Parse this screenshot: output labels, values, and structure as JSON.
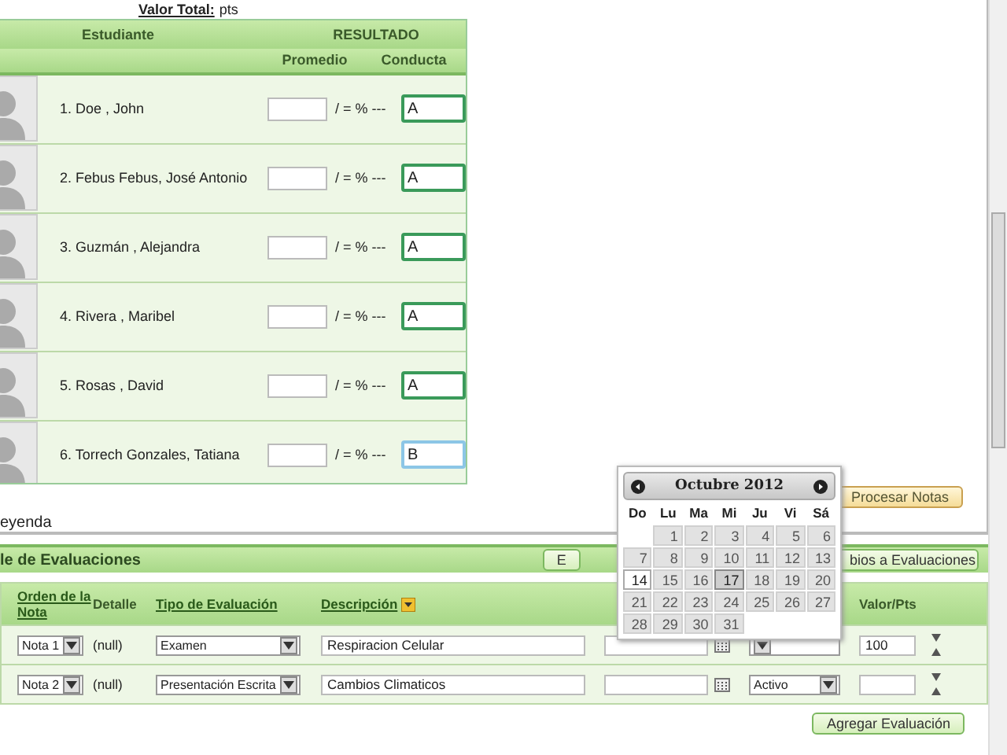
{
  "summary": {
    "label": "Valor Total:",
    "unit": "pts"
  },
  "students_table": {
    "headers": {
      "student": "Estudiante",
      "result": "RESULTADO",
      "average": "Promedio",
      "conduct": "Conducta"
    },
    "rows": [
      {
        "name": "1. Doe , John",
        "formula": "/ = % ---",
        "conduct": "A",
        "focused": false
      },
      {
        "name": "2. Febus Febus, José Antonio",
        "formula": "/ = % ---",
        "conduct": "A",
        "focused": false
      },
      {
        "name": "3. Guzmán , Alejandra",
        "formula": "/ = % ---",
        "conduct": "A",
        "focused": false
      },
      {
        "name": "4. Rivera , Maribel",
        "formula": "/ = % ---",
        "conduct": "A",
        "focused": false
      },
      {
        "name": "5. Rosas , David",
        "formula": "/ = % ---",
        "conduct": "A",
        "focused": false
      },
      {
        "name": "6. Torrech Gonzales, Tatiana",
        "formula": "/ = % ---",
        "conduct": "B",
        "focused": true
      }
    ]
  },
  "legend": "eyenda",
  "process_button": "Procesar Notas",
  "evaluations": {
    "title": "le de Evaluaciones",
    "buttons": [
      "E",
      "bios a Evaluaciones"
    ],
    "columns": {
      "order": "Orden de la Nota",
      "detail": "Detalle",
      "type": "Tipo de Evaluación",
      "description": "Descripción",
      "value": "Valor/Pts"
    },
    "rows": [
      {
        "order": "Nota 1",
        "detail": "(null)",
        "type": "Examen",
        "description": "Respiracion Celular",
        "status": null,
        "value": "100"
      },
      {
        "order": "Nota 2",
        "detail": "(null)",
        "type": "Presentación Escrita",
        "description": "Cambios Climaticos",
        "status": "Activo",
        "value": null
      }
    ],
    "add_button": "Agregar Evaluación"
  },
  "datepicker": {
    "title": "Octubre 2012",
    "weekdays": [
      "Do",
      "Lu",
      "Ma",
      "Mi",
      "Ju",
      "Vi",
      "Sá"
    ],
    "weeks": [
      {
        "days": [
          {
            "label": "1",
            "today": false,
            "selected": false
          },
          {
            "label": "2",
            "today": false,
            "selected": false
          },
          {
            "label": "3",
            "today": false,
            "selected": false
          },
          {
            "label": "4",
            "today": false,
            "selected": false
          },
          {
            "label": "5",
            "today": false,
            "selected": false
          },
          {
            "label": "6",
            "today": false,
            "selected": false
          }
        ]
      },
      {
        "days": [
          {
            "label": "7",
            "today": false,
            "selected": false
          },
          {
            "label": "8",
            "today": false,
            "selected": false
          },
          {
            "label": "9",
            "today": false,
            "selected": false
          },
          {
            "label": "10",
            "today": false,
            "selected": false
          },
          {
            "label": "11",
            "today": false,
            "selected": false
          },
          {
            "label": "12",
            "today": false,
            "selected": false
          },
          {
            "label": "13",
            "today": false,
            "selected": false
          }
        ]
      },
      {
        "days": [
          {
            "label": "14",
            "today": true,
            "selected": false
          },
          {
            "label": "15",
            "today": false,
            "selected": false
          },
          {
            "label": "16",
            "today": false,
            "selected": false
          },
          {
            "label": "17",
            "today": false,
            "selected": true
          },
          {
            "label": "18",
            "today": false,
            "selected": false
          },
          {
            "label": "19",
            "today": false,
            "selected": false
          },
          {
            "label": "20",
            "today": false,
            "selected": false
          }
        ]
      },
      {
        "days": [
          {
            "label": "21",
            "today": false,
            "selected": false
          },
          {
            "label": "22",
            "today": false,
            "selected": false
          },
          {
            "label": "23",
            "today": false,
            "selected": false
          },
          {
            "label": "24",
            "today": false,
            "selected": false
          },
          {
            "label": "25",
            "today": false,
            "selected": false
          },
          {
            "label": "26",
            "today": false,
            "selected": false
          },
          {
            "label": "27",
            "today": false,
            "selected": false
          }
        ]
      },
      {
        "days": [
          {
            "label": "28",
            "today": false,
            "selected": false
          },
          {
            "label": "29",
            "today": false,
            "selected": false
          },
          {
            "label": "30",
            "today": false,
            "selected": false
          },
          {
            "label": "31",
            "today": false,
            "selected": false
          }
        ]
      }
    ]
  }
}
